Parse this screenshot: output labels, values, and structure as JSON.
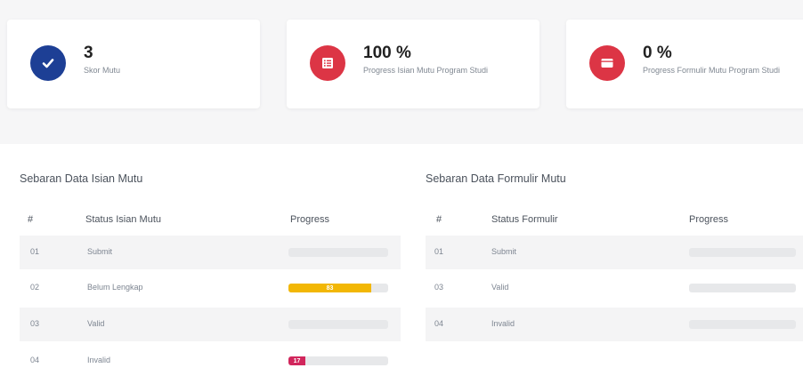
{
  "cards": [
    {
      "value": "3",
      "label": "Skor Mutu",
      "icon": "check-circle-icon",
      "color": "#1d3f95"
    },
    {
      "value": "100 %",
      "label": "Progress Isian Mutu Program Studi",
      "icon": "list-icon",
      "color": "#dc3545"
    },
    {
      "value": "0 %",
      "label": "Progress Formulir Mutu Program Studi",
      "icon": "form-icon",
      "color": "#dc3545"
    }
  ],
  "left_panel": {
    "title": "Sebaran Data Isian Mutu",
    "headers": [
      "#",
      "Status Isian Mutu",
      "Progress"
    ],
    "rows": [
      {
        "no": "01",
        "status": "Submit",
        "progress": 0,
        "badge": "",
        "color": "#e7e8ea"
      },
      {
        "no": "02",
        "status": "Belum Lengkap",
        "progress": 0.83,
        "badge": "83",
        "color": "#f2b705"
      },
      {
        "no": "03",
        "status": "Valid",
        "progress": 0,
        "badge": "",
        "color": "#e7e8ea"
      },
      {
        "no": "04",
        "status": "Invalid",
        "progress": 0.17,
        "badge": "17",
        "color": "#d1265c"
      }
    ]
  },
  "right_panel": {
    "title": "Sebaran Data Formulir Mutu",
    "headers": [
      "#",
      "Status Formulir",
      "Progress"
    ],
    "rows": [
      {
        "no": "01",
        "status": "Submit",
        "progress": 0,
        "badge": "",
        "color": "#e7e8ea"
      },
      {
        "no": "03",
        "status": "Valid",
        "progress": 0,
        "badge": "",
        "color": "#e7e8ea"
      },
      {
        "no": "04",
        "status": "Invalid",
        "progress": 0,
        "badge": "",
        "color": "#e7e8ea"
      }
    ]
  }
}
